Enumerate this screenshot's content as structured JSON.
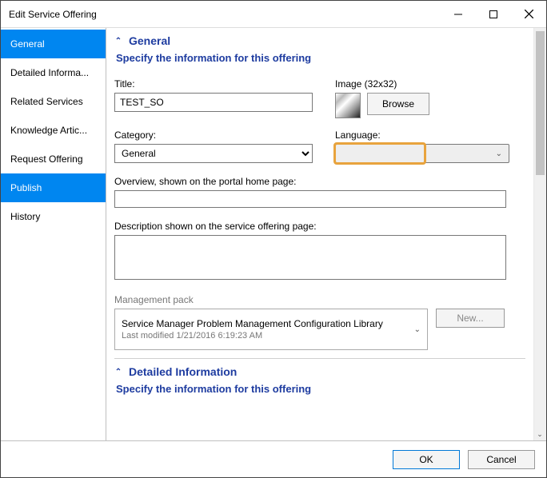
{
  "window": {
    "title": "Edit Service Offering"
  },
  "sidebar": {
    "items": [
      {
        "label": "General",
        "selected": true
      },
      {
        "label": "Detailed Informa...",
        "selected": false
      },
      {
        "label": "Related Services",
        "selected": false
      },
      {
        "label": "Knowledge Artic...",
        "selected": false
      },
      {
        "label": "Request Offering",
        "selected": false
      },
      {
        "label": "Publish",
        "selected": true
      },
      {
        "label": "History",
        "selected": false
      }
    ]
  },
  "section_general": {
    "header": "General",
    "sub": "Specify the information for this offering",
    "title_label": "Title:",
    "title_value": "TEST_SO",
    "image_label": "Image (32x32)",
    "browse_label": "Browse",
    "category_label": "Category:",
    "category_value": "General",
    "language_label": "Language:",
    "language_value": "",
    "overview_label": "Overview, shown on the portal home page:",
    "overview_value": "",
    "description_label": "Description shown on the service offering page:",
    "description_value": "",
    "mgmt_label": "Management pack",
    "mgmt_value": "Service Manager Problem Management Configuration Library",
    "mgmt_modified": "Last modified  1/21/2016 6:19:23 AM",
    "new_label": "New..."
  },
  "section_detailed": {
    "header": "Detailed Information",
    "sub": "Specify the information for this offering"
  },
  "footer": {
    "ok": "OK",
    "cancel": "Cancel"
  }
}
